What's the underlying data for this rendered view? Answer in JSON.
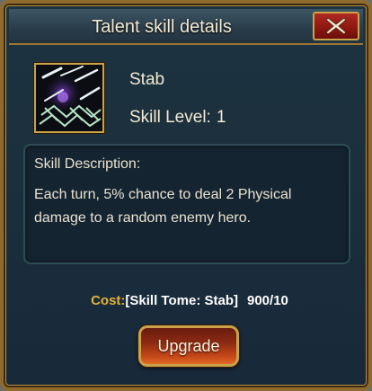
{
  "window": {
    "title": "Talent skill details"
  },
  "skill": {
    "icon": "crossed-blades-icon",
    "name": "Stab",
    "level_label": "Skill Level:",
    "level_value": "1"
  },
  "description": {
    "title": "Skill Description:",
    "text": "Each turn, 5% chance to deal 2 Physical damage to a random enemy hero."
  },
  "cost": {
    "label": "Cost:",
    "item": "[Skill Tome: Stab]",
    "count": "900/10"
  },
  "buttons": {
    "upgrade": "Upgrade",
    "close": "close-icon"
  },
  "colors": {
    "frame_gold": "#c9a24a",
    "panel_blue": "#1b2f3c",
    "cost_label": "#e3b23b",
    "close_red": "#8e1812",
    "upgrade_orange": "#c7491a"
  }
}
